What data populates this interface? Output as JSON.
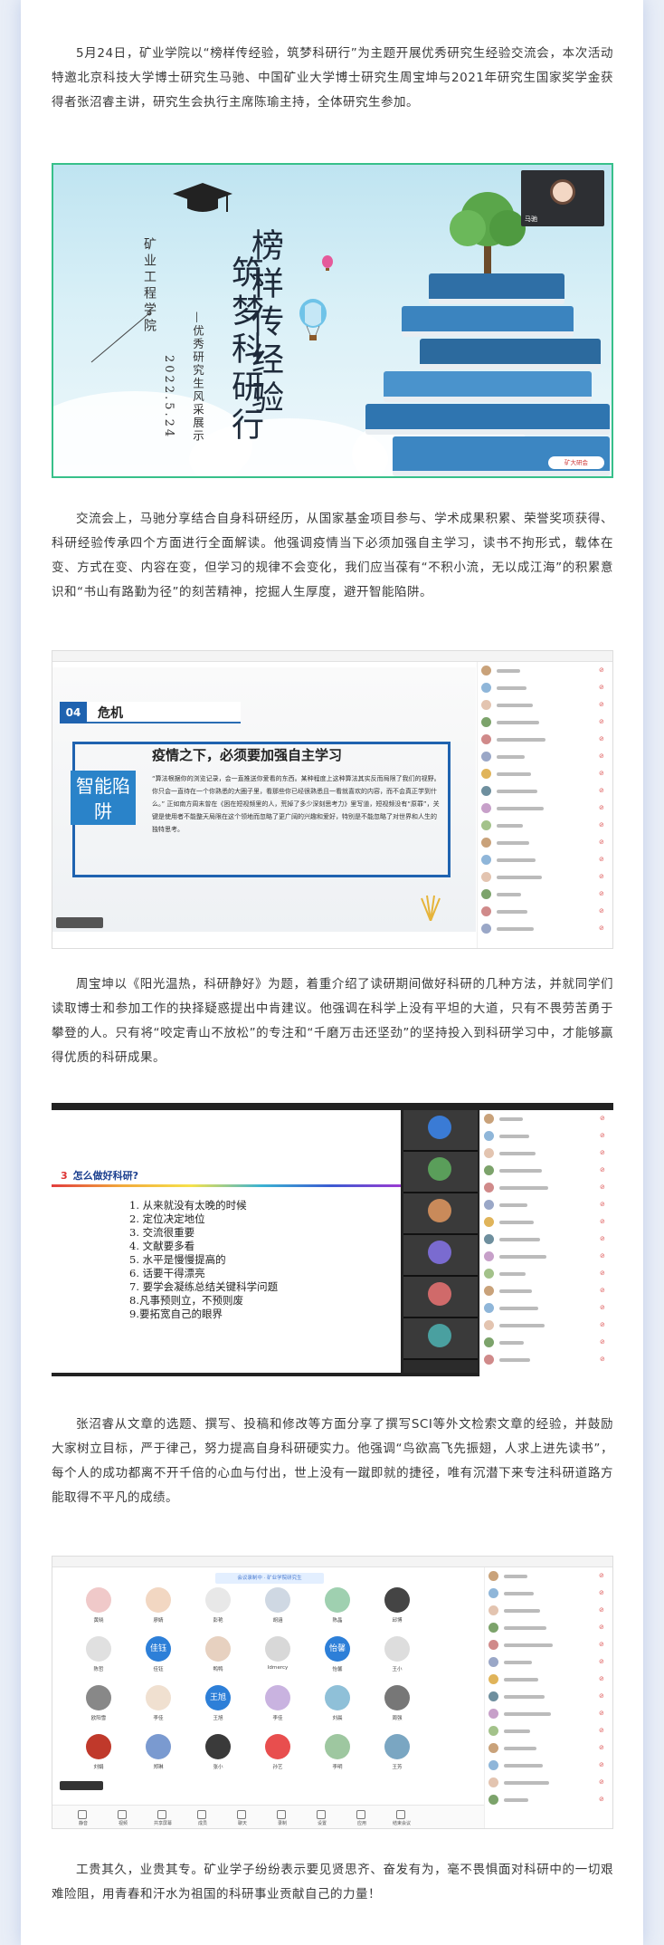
{
  "paragraphs": {
    "p1": "5月24日，矿业学院以“榜样传经验，筑梦科研行”为主题开展优秀研究生经验交流会，本次活动特邀北京科技大学博士研究生马驰、中国矿业大学博士研究生周宝坤与2021年研究生国家奖学金获得者张沼睿主讲，研究生会执行主席陈瑜主持，全体研究生参加。",
    "p2": "交流会上，马驰分享结合自身科研经历，从国家基金项目参与、学术成果积累、荣誉奖项获得、科研经验传承四个方面进行全面解读。他强调疫情当下必须加强自主学习，读书不拘形式，载体在变、方式在变、内容在变，但学习的规律不会变化，我们应当葆有“不积小流，无以成江海”的积累意识和“书山有路勤为径”的刻苦精神，挖掘人生厚度，避开智能陷阱。",
    "p3": "周宝坤以《阳光温热，科研静好》为题，着重介绍了读研期间做好科研的几种方法，并就同学们读取博士和参加工作的抉择疑惑提出中肯建议。他强调在科学上没有平坦的大道，只有不畏劳苦勇于攀登的人。只有将“咬定青山不放松”的专注和“千磨万击还坚劲”的坚持投入到科研学习中，才能够赢得优质的科研成果。",
    "p4": "张沼睿从文章的选题、撰写、投稿和修改等方面分享了撰写SCI等外文检索文章的经验，并鼓励大家树立目标，严于律己，努力提高自身科研硬实力。他强调“鸟欲高飞先振翅，人求上进先读书”，每个人的成功都离不开千倍的心血与付出，世上没有一蹴即就的捷径，唯有沉潜下来专注科研道路方能取得不平凡的成绩。",
    "p5": "工贵其久，业贵其专。矿业学子纷纷表示要见贤思齐、奋发有为，毫不畏惧面对科研中的一切艰难险阻，用青春和汗水为祖国的科研事业贡献自己的力量！"
  },
  "banner": {
    "title_line1": "榜样传经验",
    "title_line2": "筑梦科研行",
    "subtitle": "—优秀研究生风采展示",
    "school": "矿业工程学院",
    "date": "2022.5.24",
    "video_name": "马驰",
    "logo": "矿大研会"
  },
  "slide_crisis": {
    "num": "04",
    "heading": "危机",
    "box": "智能陷阱",
    "title": "疫情之下，必须要加强自主学习",
    "text": "“算法根据你的浏览记录，会一直推送你爱看的东西。某种程度上这种算法其实反而局限了我们的视野。你只会一直待在一个你熟悉的大圈子里，看那些你已经很熟悉且一看就喜欢的内容，而不会真正学到什么。” 正如南方周末曾在《困在短视频里的人，荒掉了多少深刻思考力》里写道，短视频没有“原罪”，关键是使用者不能整天局限在这个领地而忽略了更广阔的兴趣和爱好，特别是不能忽略了对世界和人生的独特思考。"
  },
  "slide_research": {
    "num": "3",
    "heading": "怎么做好科研?",
    "items": [
      "1. 从来就没有太晚的时候",
      "2. 定位决定地位",
      "3. 交流很重要",
      "4. 文献要多看",
      "5. 水平是慢慢提高的",
      "6. 话要干得漂亮",
      "7. 要学会凝练总结关键科学问题",
      "8.凡事预则立，不预则废",
      "9.要拓宽自己的眼界"
    ]
  },
  "meeting_grid": {
    "tip": "会议录制中 · 矿业学院研究生",
    "names": [
      "黄晓",
      "廖婧",
      "彭艳",
      "胡涵",
      "陈晶",
      "邱博",
      "陈哲",
      "佳钰",
      "鸭鸭",
      "Idrnercy",
      "怡馨",
      "王小",
      "欧阳雪",
      "李佳",
      "王旭",
      "李佳",
      "刘晨",
      "周强",
      "刘娟",
      "郑琳",
      "张小",
      "孙艺",
      "李明",
      "王芳"
    ],
    "tile_texts": [
      "佳钰",
      "怡馨",
      "王旭"
    ],
    "bottom": [
      "静音",
      "视频",
      "共享屏幕",
      "成员",
      "聊天",
      "录制",
      "设置",
      "应用",
      "结束会议"
    ]
  },
  "colors": {
    "accent_blue": "#1f63b0",
    "frame_green": "#37c08a"
  }
}
